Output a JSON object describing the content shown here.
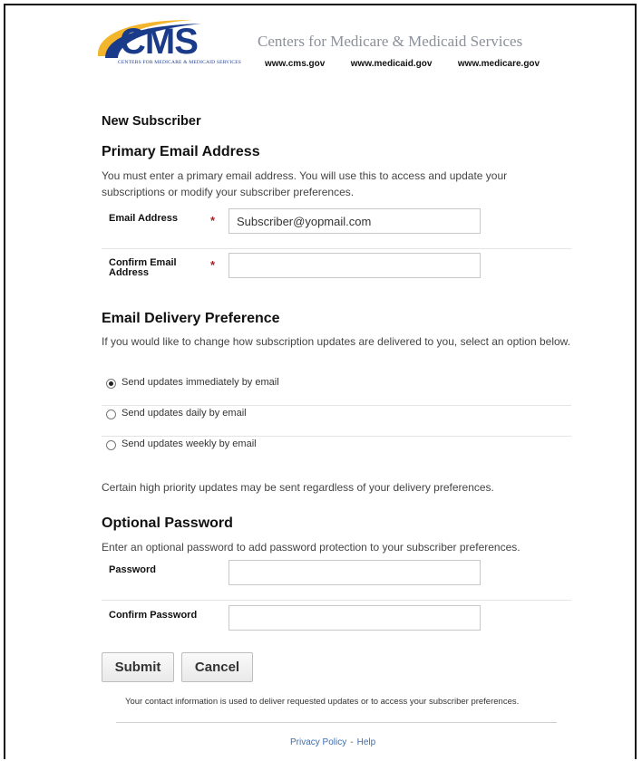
{
  "header": {
    "logo_text": "CMS",
    "logo_subtitle": "CENTERS FOR MEDICARE & MEDICAID SERVICES",
    "org_name": "Centers for Medicare & Medicaid Services",
    "links": [
      "www.cms.gov",
      "www.medicaid.gov",
      "www.medicare.gov"
    ],
    "brand_color": "#1a3a8a",
    "swoosh_color": "#f2b52c"
  },
  "page_title": "New Subscriber",
  "primary_email": {
    "heading": "Primary Email Address",
    "description": "You must enter a primary email address. You will use this to access and update your subscriptions or modify your subscriber preferences.",
    "email_label": "Email Address",
    "email_value": "Subscriber@yopmail.com",
    "confirm_label": "Confirm Email Address",
    "confirm_value": "",
    "required_marker": "*"
  },
  "delivery": {
    "heading": "Email Delivery Preference",
    "description": "If you would like to change how subscription updates are delivered to you, select an option below.",
    "options": [
      {
        "label": "Send updates immediately by email",
        "checked": true
      },
      {
        "label": "Send updates daily by email",
        "checked": false
      },
      {
        "label": "Send updates weekly by email",
        "checked": false
      }
    ],
    "note": "Certain high priority updates may be sent regardless of your delivery preferences."
  },
  "password": {
    "heading": "Optional Password",
    "description": "Enter an optional password to add password protection to your subscriber preferences.",
    "password_label": "Password",
    "confirm_label": "Confirm Password"
  },
  "buttons": {
    "submit": "Submit",
    "cancel": "Cancel"
  },
  "footer": {
    "note": "Your contact information is used to deliver requested updates or to access your subscriber preferences.",
    "privacy": "Privacy Policy",
    "separator": "-",
    "help": "Help"
  }
}
